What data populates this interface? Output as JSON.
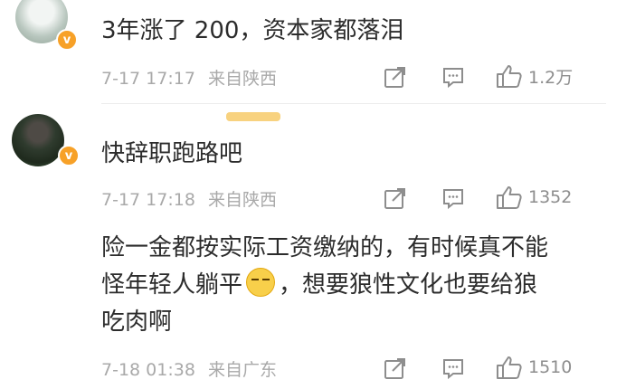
{
  "comments": [
    {
      "user": "",
      "text": "3年涨了 200，资本家都落泪",
      "time": "7-17 17:17",
      "source": "来自陕西",
      "likes": "1.2万",
      "verified": "v"
    },
    {
      "user": "",
      "text": "快辞职跑路吧",
      "time": "7-17 17:18",
      "source": "来自陕西",
      "likes": "1352",
      "verified": "v"
    },
    {
      "text_line1": "险一金都按实际工资缴纳的，有时候真不能",
      "text_line2_a": "怪年轻人躺平",
      "text_line2_b": "，想要狼性文化也要给狼",
      "text_line3": "吃肉啊",
      "time": "7-18 01:38",
      "source": "来自广东",
      "likes": "1510"
    }
  ],
  "icons": {
    "share": "share-icon",
    "comment": "comment-icon",
    "like": "like-icon",
    "emoji": "emoji-icon"
  },
  "colors": {
    "text": "#2c2c2c",
    "meta": "#a9a9a9",
    "badge": "#f7a128",
    "icon": "#8d8d8d"
  }
}
